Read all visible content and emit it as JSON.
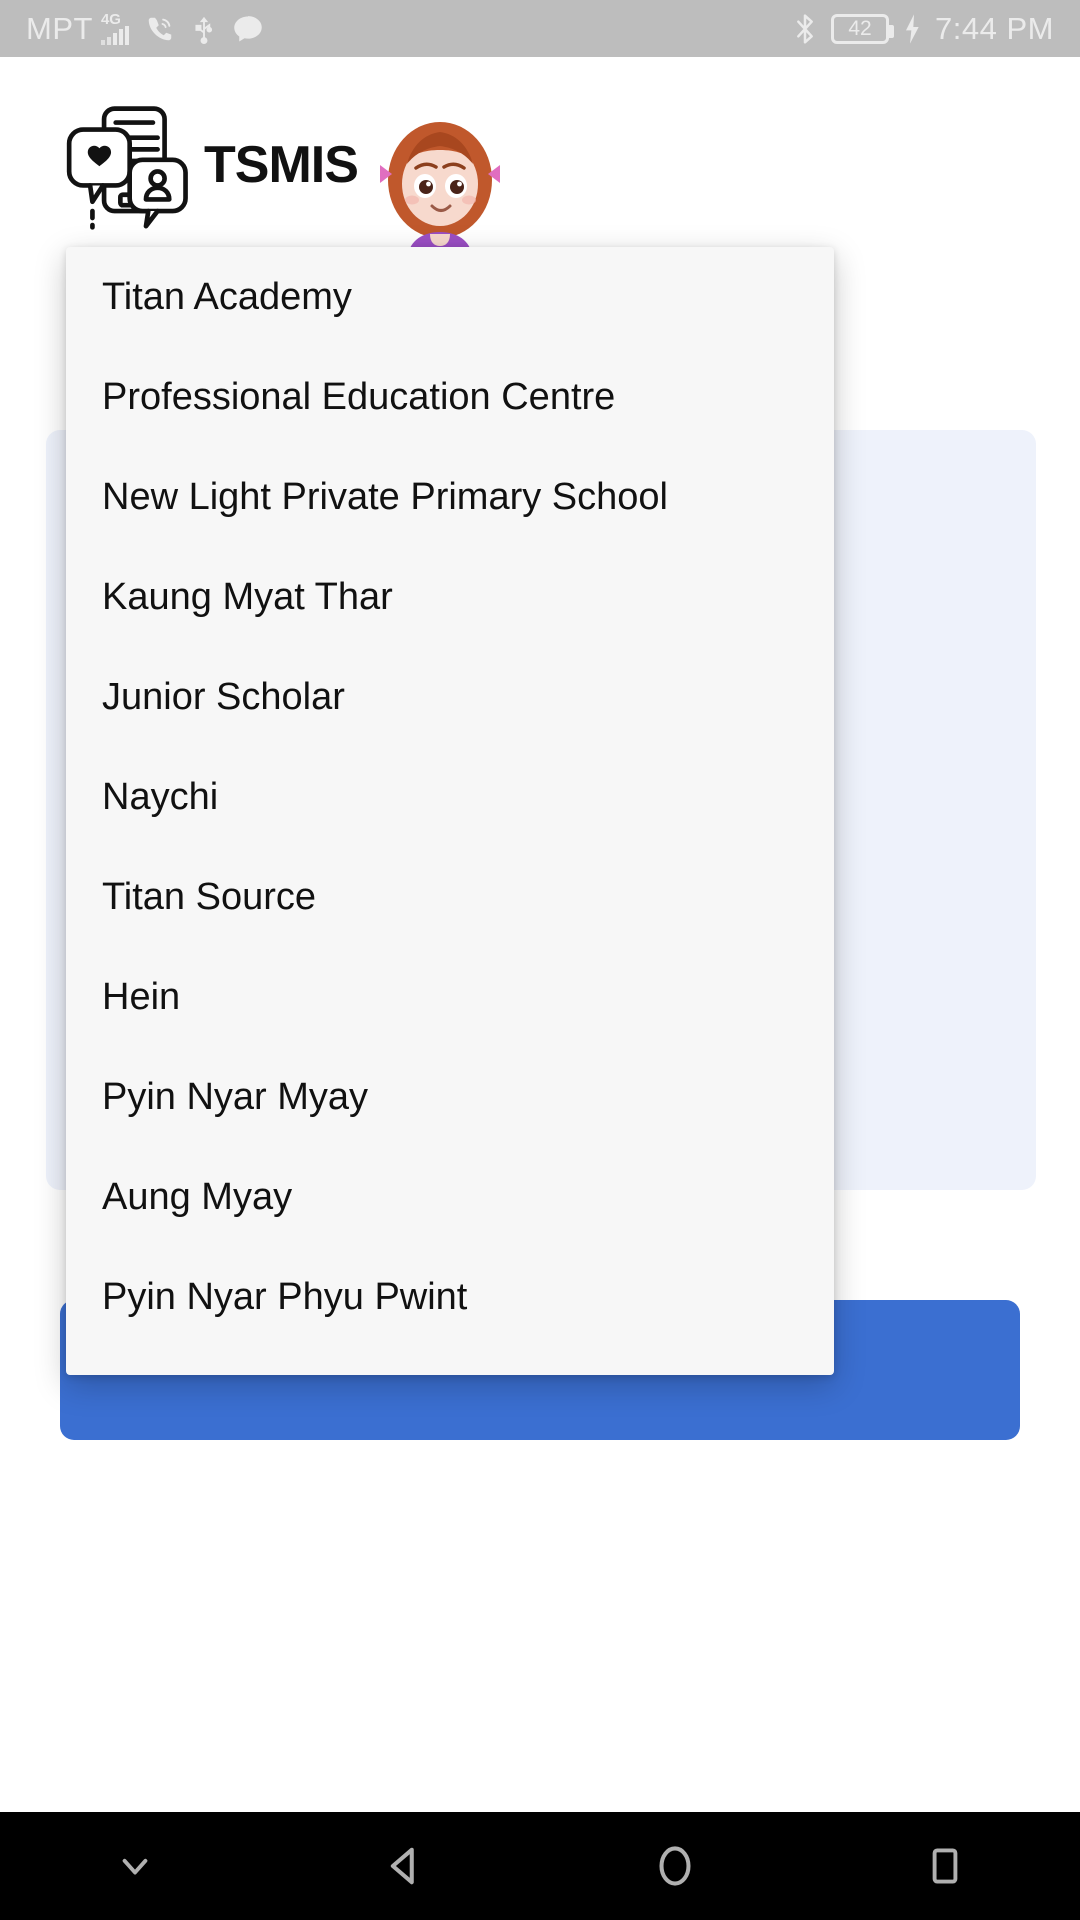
{
  "status_bar": {
    "carrier": "MPT",
    "network": "4G",
    "icons": [
      "signal-bars-icon",
      "viber-call-icon",
      "usb-icon",
      "message-bubble-icon",
      "bluetooth-icon"
    ],
    "battery_percent": "42",
    "charging": true,
    "time": "7:44 PM"
  },
  "header": {
    "app_name": "TSMIS",
    "logo_icon": "tsmis-chat-phone-logo",
    "mascot_icon": "girl-student-illustration"
  },
  "dropdown": {
    "name": "school-select-dropdown",
    "items": [
      {
        "label": "Titan Academy"
      },
      {
        "label": "Professional Education Centre"
      },
      {
        "label": "New Light Private Primary School"
      },
      {
        "label": "Kaung Myat Thar"
      },
      {
        "label": "Junior Scholar"
      },
      {
        "label": "Naychi"
      },
      {
        "label": "Titan Source"
      },
      {
        "label": "Hein"
      },
      {
        "label": "Pyin Nyar Myay"
      },
      {
        "label": "Aung Myay"
      },
      {
        "label": "Pyin Nyar Phyu Pwint"
      }
    ]
  },
  "nav_bar": {
    "buttons": [
      {
        "name": "hide-keyboard-icon"
      },
      {
        "name": "back-icon"
      },
      {
        "name": "home-icon"
      },
      {
        "name": "recents-icon"
      }
    ]
  },
  "colors": {
    "accent_blue": "#3b6fd1",
    "status_bar_bg": "#bdbdbd",
    "panel_bg": "#f7f7f7",
    "nav_bg": "#000000",
    "text": "#111111"
  }
}
